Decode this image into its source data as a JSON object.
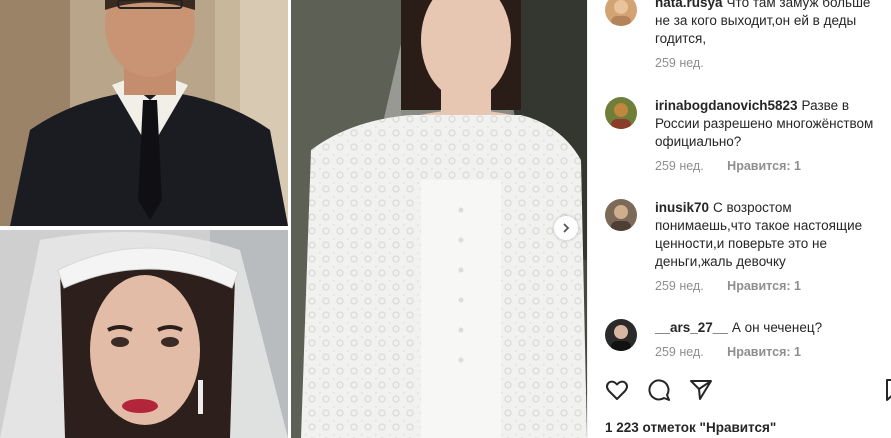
{
  "comments": [
    {
      "username": "nata.rusya",
      "text": "Что там замуж больше не за кого выходит,он ей в деды годится,",
      "time": "259 нед.",
      "likes": ""
    },
    {
      "username": "irinabogdanovich5823",
      "text": "Разве в России разрешено многожёнством официально?",
      "time": "259 нед.",
      "likes": "Нравится: 1"
    },
    {
      "username": "inusik70",
      "text": "С возростом понимаешь,что такое настоящие ценности,и поверьте это не деньги,жаль девочку",
      "time": "259 нед.",
      "likes": "Нравится: 1"
    },
    {
      "username": "__ars_27__",
      "text": "А он чеченец?",
      "time": "259 нед.",
      "likes": "Нравится: 1"
    }
  ],
  "post": {
    "likes_label": "1 223 отметок \"Нравится\""
  },
  "icons": {
    "like": "heart-icon",
    "comment": "comment-icon",
    "share": "share-icon",
    "save": "bookmark-icon",
    "next": "chevron-right-icon"
  },
  "colors": {
    "text": "#262626",
    "muted": "#8e8e8e",
    "border": "#efefef"
  }
}
